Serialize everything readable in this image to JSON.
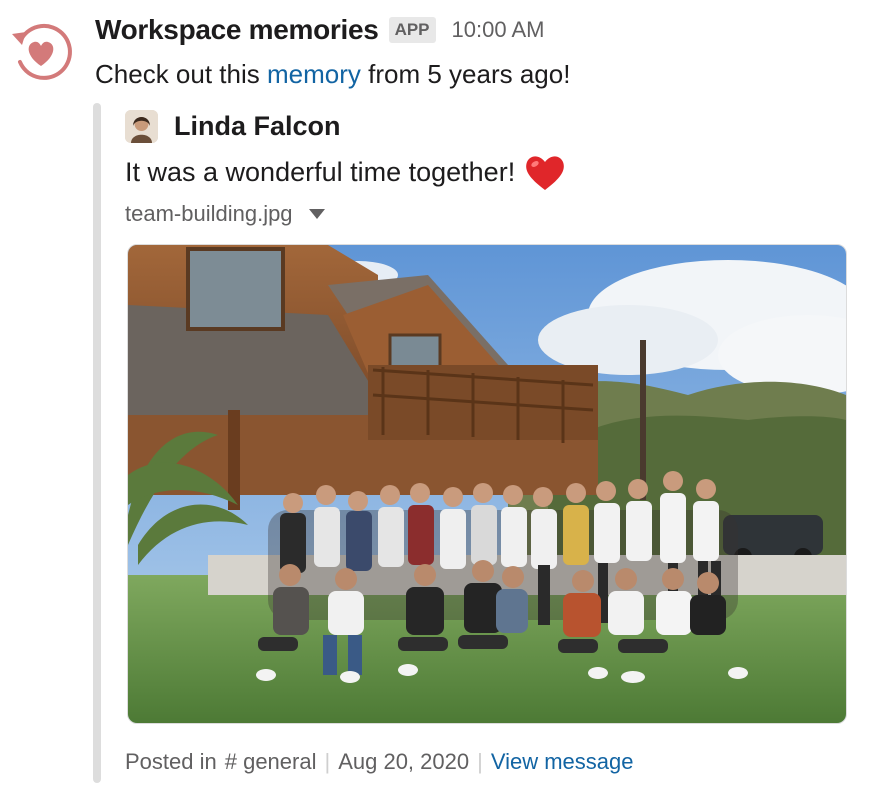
{
  "message": {
    "sender": "Workspace memories",
    "badge": "APP",
    "time": "10:00 AM",
    "intro_prefix": "Check out this ",
    "intro_link": "memory",
    "intro_suffix": " from 5 years ago!"
  },
  "quoted": {
    "author": "Linda Falcon",
    "text": "It was a wonderful time together!",
    "emoji": "heart-emoji",
    "file_name": "team-building.jpg"
  },
  "footer": {
    "posted_in": "Posted in",
    "channel": "# general",
    "date": "Aug 20, 2020",
    "view_message": "View message"
  },
  "colors": {
    "link": "#1264a3",
    "icon_accent": "#d37a7a",
    "muted": "#616061",
    "quote_bar": "#dddddd"
  }
}
